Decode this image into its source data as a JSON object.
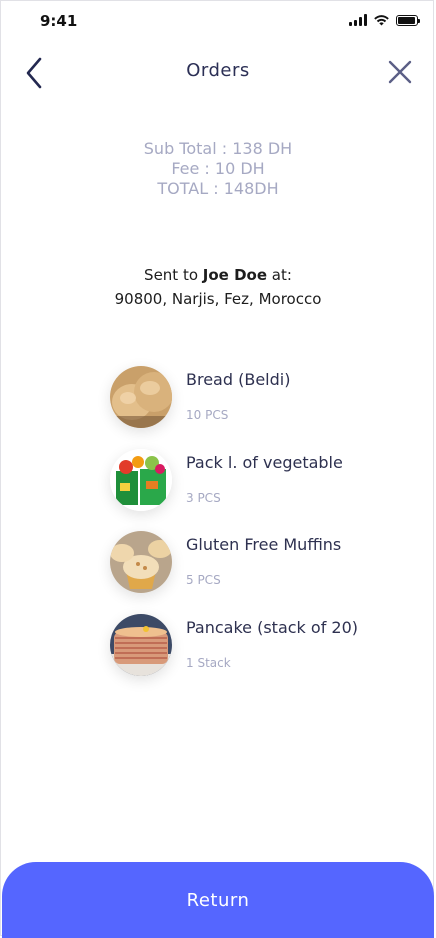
{
  "status": {
    "time": "9:41"
  },
  "header": {
    "title": "Orders"
  },
  "totals": {
    "sub_total": "Sub Total : 138 DH",
    "fee": "Fee : 10 DH",
    "total": "TOTAL : 148DH"
  },
  "shipping": {
    "prefix": "Sent to",
    "name": "Joe Doe",
    "suffix": "at:",
    "address": "90800, Narjis, Fez, Morocco"
  },
  "items": [
    {
      "name": "Bread (Beldi)",
      "qty": "10 PCS"
    },
    {
      "name": "Pack l. of vegetable",
      "qty": "3 PCS"
    },
    {
      "name": "Gluten Free Muffins",
      "qty": "5 PCS"
    },
    {
      "name": "Pancake (stack of 20)",
      "qty": "1 Stack"
    }
  ],
  "footer": {
    "return_label": "Return"
  },
  "colors": {
    "accent": "#5566ff",
    "title": "#2b2f55",
    "muted": "#a6a9c3"
  }
}
